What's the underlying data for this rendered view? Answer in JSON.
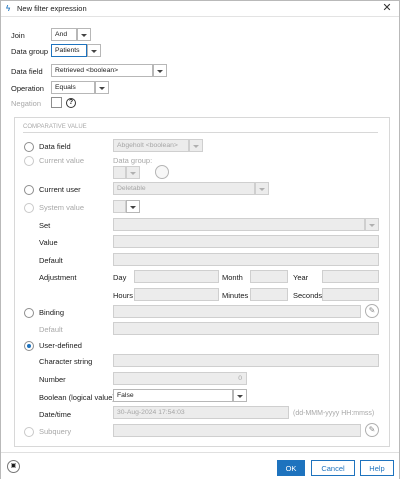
{
  "window": {
    "title": "New filter expression",
    "close_glyph": "✕",
    "icon": "filter-icon"
  },
  "header_fields": {
    "join": {
      "label": "Join",
      "value": "And"
    },
    "data_group": {
      "label": "Data group",
      "value": "Patients"
    },
    "data_field": {
      "label": "Data field",
      "value": "Retrieved <boolean>"
    },
    "operation": {
      "label": "Operation",
      "value": "Equals"
    },
    "negation": {
      "label": "Negation",
      "help_glyph": "?"
    }
  },
  "comparative": {
    "heading": "COMPARATIVE VALUE",
    "data_field": {
      "label": "Data field",
      "value": "Abgeholt <boolean>"
    },
    "current_value": {
      "label": "Current value",
      "data_group_label": "Data group:"
    },
    "current_user": {
      "label": "Current user",
      "value": "Deletable"
    },
    "system_value": {
      "label": "System value",
      "set_label": "Set",
      "value_label": "Value",
      "default_label": "Default",
      "adjustment_label": "Adjustment",
      "day": "Day",
      "month": "Month",
      "year": "Year",
      "hours": "Hours",
      "minutes": "Minutes",
      "seconds": "Seconds"
    },
    "binding": {
      "label": "Binding",
      "default_label": "Default"
    },
    "user_defined": {
      "label": "User-defined",
      "character_string_label": "Character string",
      "number_label": "Number",
      "number_value": "0",
      "boolean_label": "Boolean (logical value)",
      "boolean_value": "False",
      "datetime_label": "Date/time",
      "datetime_value": "30-Aug-2024 17:54:03",
      "datetime_format": "(dd-MMM-yyyy HH:mmss)"
    },
    "subquery": {
      "label": "Subquery"
    },
    "selected_option": "User-defined"
  },
  "footer": {
    "ok": "OK",
    "cancel": "Cancel",
    "help": "Help"
  },
  "colors": {
    "accent": "#1e73be",
    "border": "#b7b7b7",
    "disabled": "#ececec"
  }
}
